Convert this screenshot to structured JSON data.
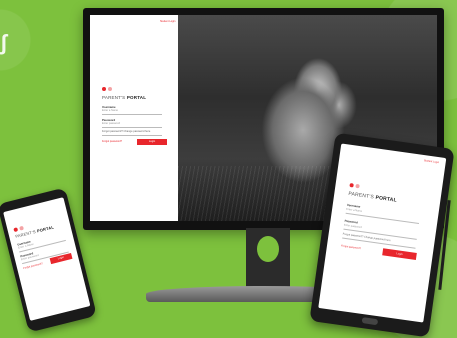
{
  "login": {
    "title_prefix": "PARENT'S ",
    "title_bold": "PORTAL",
    "username_label": "Username",
    "username_placeholder": "Enter a Name",
    "password_label": "Password",
    "password_placeholder": "Enter password",
    "remember_text": "Forgot password? Change password here",
    "forgot_link": "Forgot password?",
    "login_button": "Login",
    "top_link": "Student Login"
  },
  "colors": {
    "brand_red": "#e8262c",
    "background_green": "#7dc13d"
  }
}
